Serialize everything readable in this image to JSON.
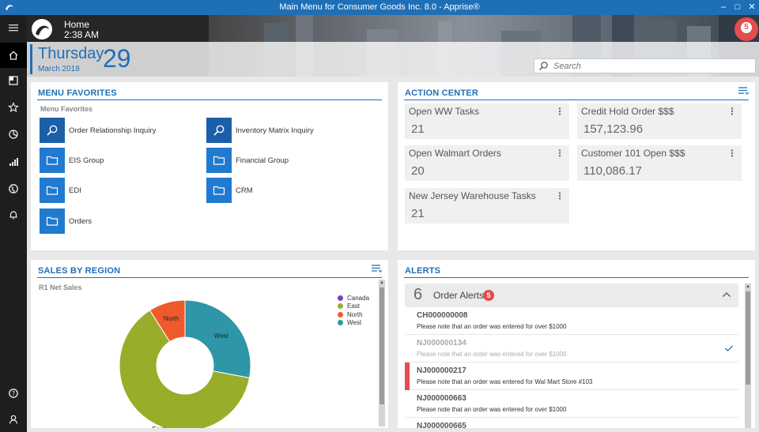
{
  "window": {
    "title": "Main Menu for Consumer Goods Inc. 8.0 - Apprise®"
  },
  "header": {
    "location": "Home",
    "time": "2:38 AM",
    "weekday": "Thursday",
    "month_year": "March 2018",
    "day": "29",
    "notification_count": "5",
    "search_placeholder": "Search"
  },
  "nav": {
    "items": [
      "menu-icon",
      "home-icon",
      "dashboard-icon",
      "star-icon",
      "pie-chart-icon",
      "bar-chart-icon",
      "globe-icon",
      "bell-icon",
      "help-icon",
      "user-icon"
    ]
  },
  "menu_favorites": {
    "title": "MENU FAVORITES",
    "subtitle": "Menu Favorites",
    "items": [
      {
        "label": "Order Relationship Inquiry",
        "icon": "search-icon"
      },
      {
        "label": "Inventory Matrix Inquiry",
        "icon": "search-icon"
      },
      {
        "label": "EIS Group",
        "icon": "folder-icon"
      },
      {
        "label": "Financial Group",
        "icon": "folder-icon"
      },
      {
        "label": "EDI",
        "icon": "folder-icon"
      },
      {
        "label": "CRM",
        "icon": "folder-icon"
      },
      {
        "label": "Orders",
        "icon": "folder-icon"
      }
    ]
  },
  "action_center": {
    "title": "ACTION CENTER",
    "cards": [
      {
        "label": "Open WW Tasks",
        "value": "21"
      },
      {
        "label": "Credit Hold Order $$$",
        "value": "157,123.96"
      },
      {
        "label": "Open Walmart Orders",
        "value": "20"
      },
      {
        "label": "Customer 101 Open $$$",
        "value": "110,086.17"
      },
      {
        "label": "New Jersey Warehouse Tasks",
        "value": "21"
      }
    ]
  },
  "sales_by_region": {
    "title": "SALES BY REGION",
    "subtitle": "R1 Net Sales"
  },
  "chart_data": {
    "type": "pie",
    "donut": true,
    "title": "R1 Net Sales",
    "categories": [
      "Canada",
      "East",
      "North",
      "West"
    ],
    "values": [
      0,
      63,
      9,
      28
    ],
    "colors": [
      "#7b3fbf",
      "#9aad2a",
      "#f05a2a",
      "#2e96a6"
    ],
    "legend": "top-right"
  },
  "alerts": {
    "title": "ALERTS",
    "group": {
      "count": "6",
      "name": "Order Alerts",
      "badge": "5"
    },
    "rows": [
      {
        "id": "CH000000008",
        "message": "Please note that an order was entered for over $1000",
        "read": false,
        "flagged": false
      },
      {
        "id": "NJ000000134",
        "message": "Please note that an order was entered for over $1000",
        "read": true,
        "flagged": false
      },
      {
        "id": "NJ000000217",
        "message": "Please note that an order was entered for Wal Mart Store #103",
        "read": false,
        "flagged": true
      },
      {
        "id": "NJ000000663",
        "message": "Please note that an order was entered for over $1000",
        "read": false,
        "flagged": false
      },
      {
        "id": "NJ000000665",
        "message": "",
        "read": false,
        "flagged": false
      }
    ]
  },
  "colors": {
    "accent": "#1f6fb7",
    "alert": "#e34d4d",
    "tile": "#1f7ad0"
  }
}
